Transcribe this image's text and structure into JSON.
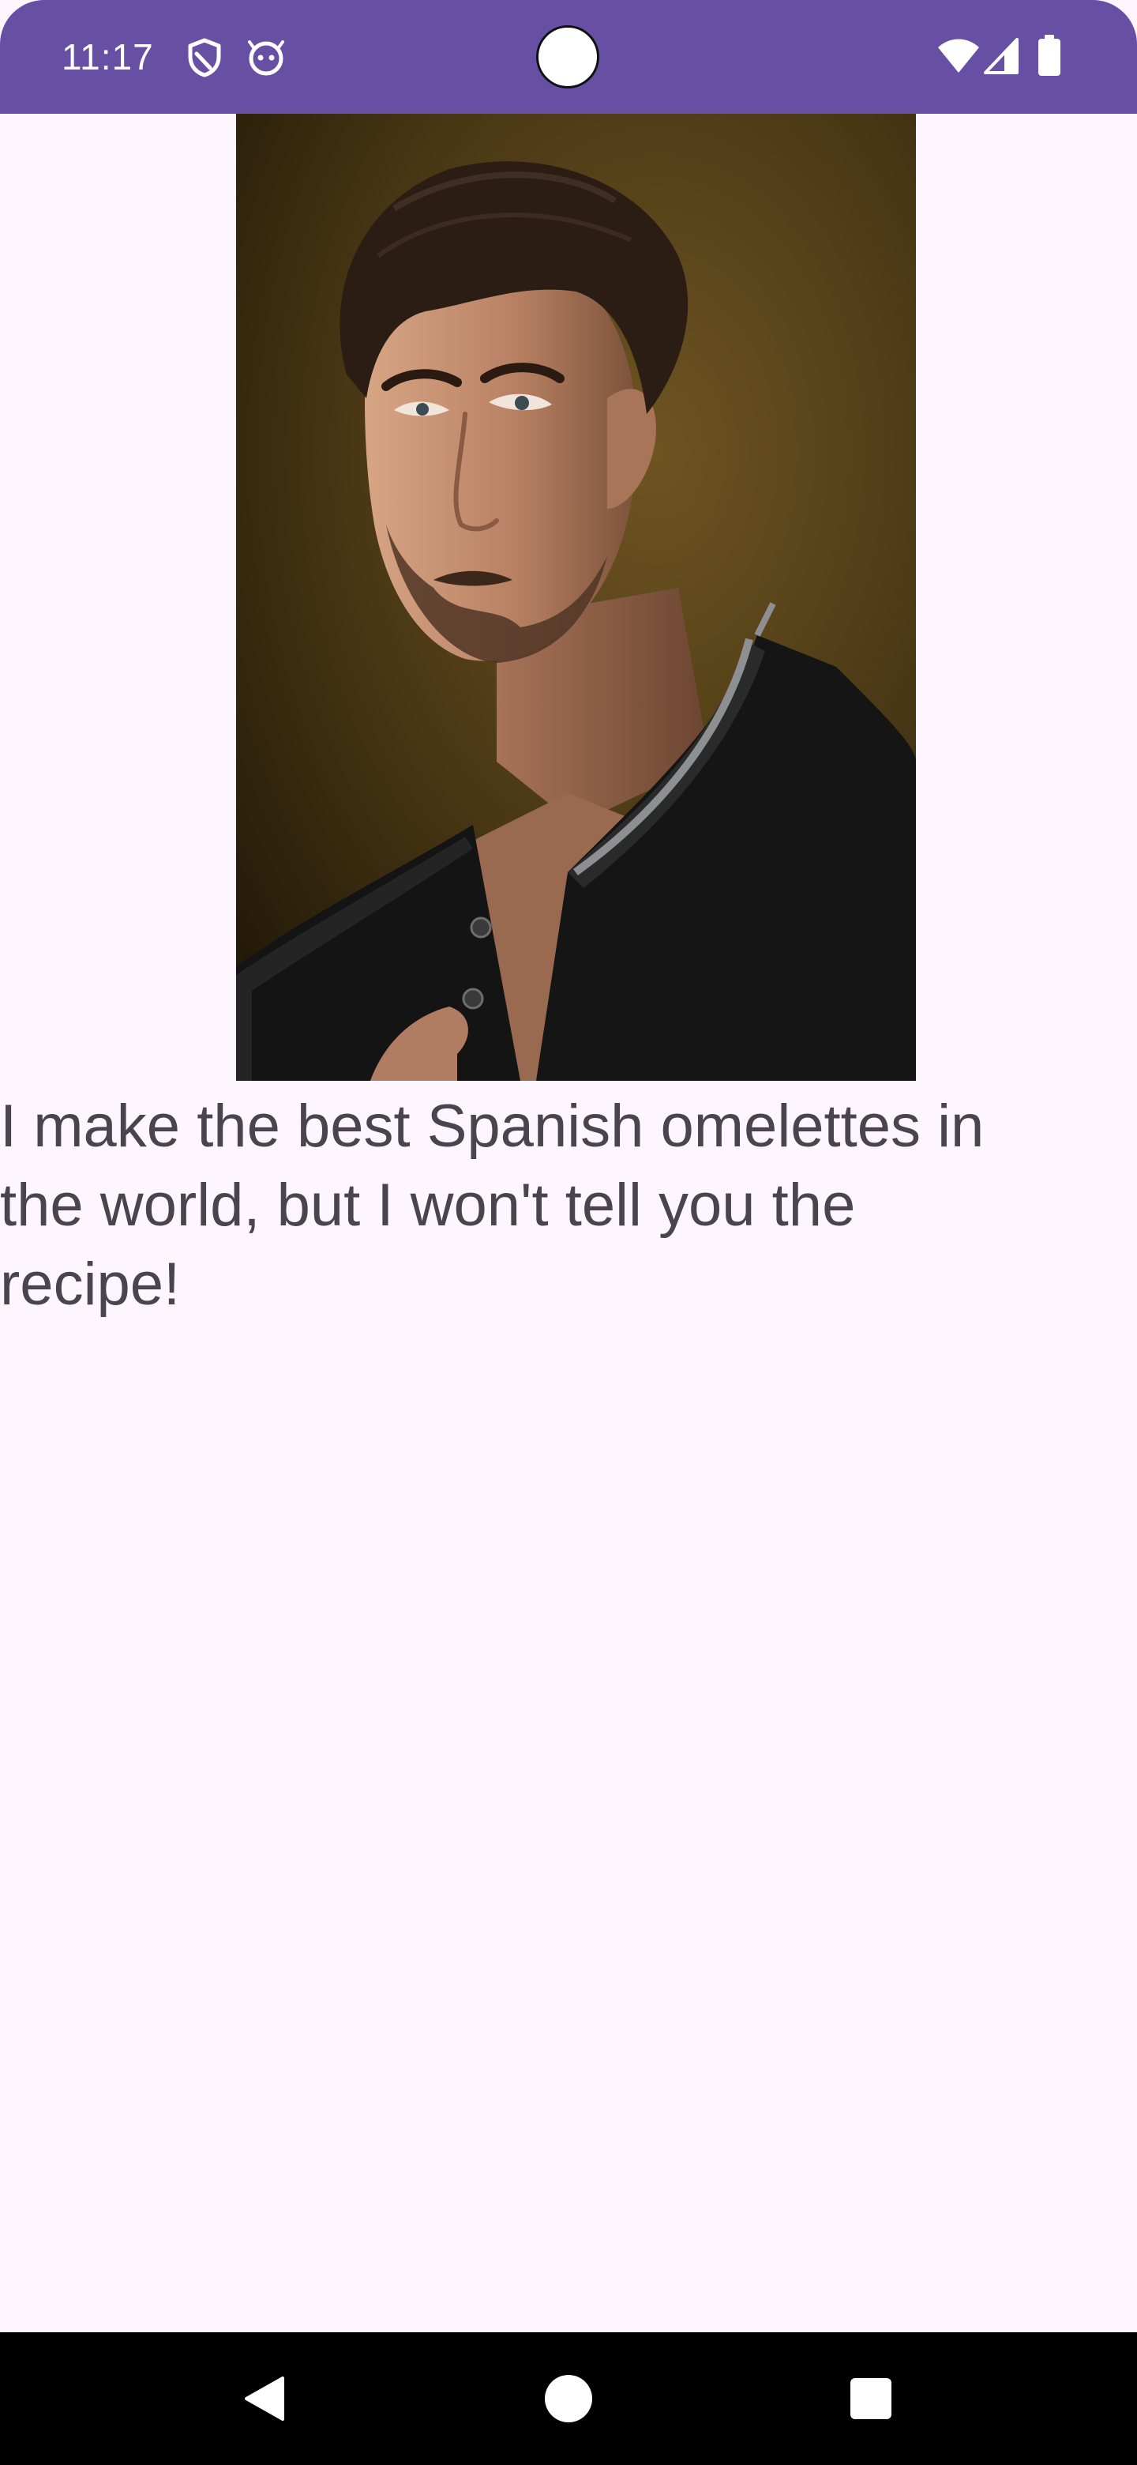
{
  "status_bar": {
    "time": "11:17",
    "background": "#6750a4",
    "left_icons": [
      "shield-icon",
      "android-face-icon"
    ],
    "right_icons": [
      "wifi-icon",
      "cell-signal-icon",
      "battery-icon"
    ]
  },
  "profile": {
    "photo_alt": "",
    "caption": "I make the best Spanish omelettes in the world, but I won't tell you the recipe!",
    "caption_color": "#49454f",
    "background": "#fdf6fe"
  },
  "navigation_bar": {
    "buttons": [
      "back-icon",
      "home-icon",
      "recents-icon"
    ]
  }
}
